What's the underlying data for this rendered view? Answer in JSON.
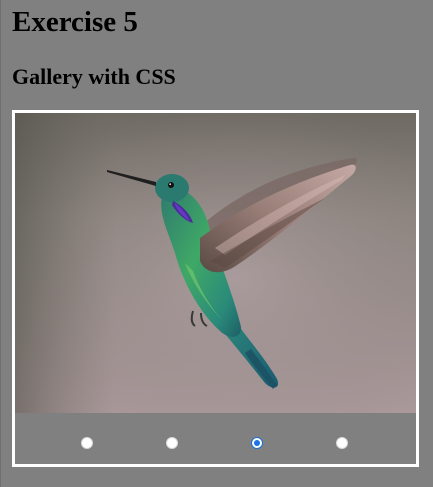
{
  "page": {
    "title": "Exercise 5",
    "subtitle": "Gallery with CSS"
  },
  "gallery": {
    "slide_icon": "hummingbird-photo",
    "selected_index": 2,
    "slide_count": 4,
    "colors": {
      "frame": "#ffffff",
      "controls_bg": "#808080",
      "radio_selected": "#1a73e8"
    }
  }
}
